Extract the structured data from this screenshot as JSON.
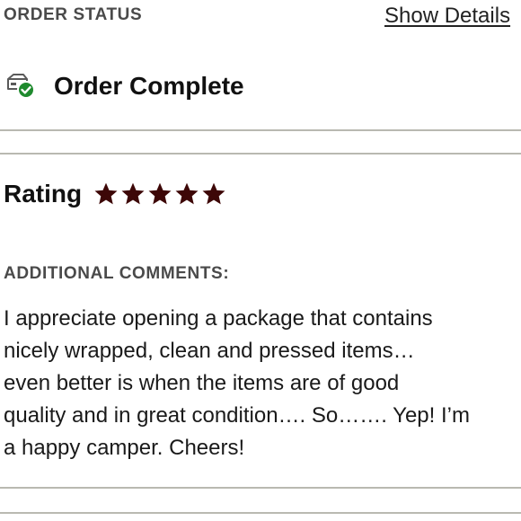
{
  "order": {
    "section_label": "ORDER STATUS",
    "show_details_label": "Show Details",
    "status_text": "Order Complete",
    "status_icon": "package-check-icon",
    "status_color": "#1f8a2e"
  },
  "rating": {
    "label": "Rating",
    "stars": 5,
    "max_stars": 5,
    "star_color": "#3d0707",
    "star_icon": "star-icon"
  },
  "comments": {
    "section_label": "ADDITIONAL COMMENTS:",
    "text": "I appreciate opening a package that contains\nnicely wrapped, clean and pressed items…\neven better is when the items are of good\nquality and in great condition…. So……. Yep! I’m\na happy camper. Cheers!"
  }
}
